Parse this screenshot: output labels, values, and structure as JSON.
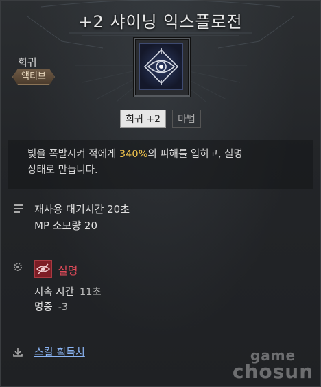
{
  "skill": {
    "title": "+2 샤이닝 익스플로전",
    "rarity": "희귀",
    "type": "액티브",
    "tags": {
      "enhance": "희귀 +2",
      "category": "마법"
    },
    "description": {
      "line1_prefix": "빛을 폭발시켜 적에게 ",
      "line1_highlight": "340%",
      "line1_suffix": "의 피해를 입히고, 실명",
      "line2": "상태로 만듭니다."
    },
    "stats": {
      "cooldown": "재사용 대기시간 20초",
      "mp_cost": "MP 소모량 20"
    },
    "status_effect": {
      "name": "실명",
      "duration_label": "지속 시간",
      "duration_value": "11초",
      "accuracy_label": "명중",
      "accuracy_value": "-3"
    },
    "acquisition_link": "스킬 획득처"
  },
  "watermark": {
    "line1": "game",
    "line2": "chosun"
  },
  "colors": {
    "highlight": "#f0c34c",
    "status_red": "#e24b5a",
    "link_blue": "#8ab4f2",
    "badge_brown": "#6e5a45"
  },
  "icons": [
    "blinding-eye-emblem-icon",
    "list-icon",
    "gear-icon",
    "blind-eye-icon",
    "download-icon"
  ]
}
